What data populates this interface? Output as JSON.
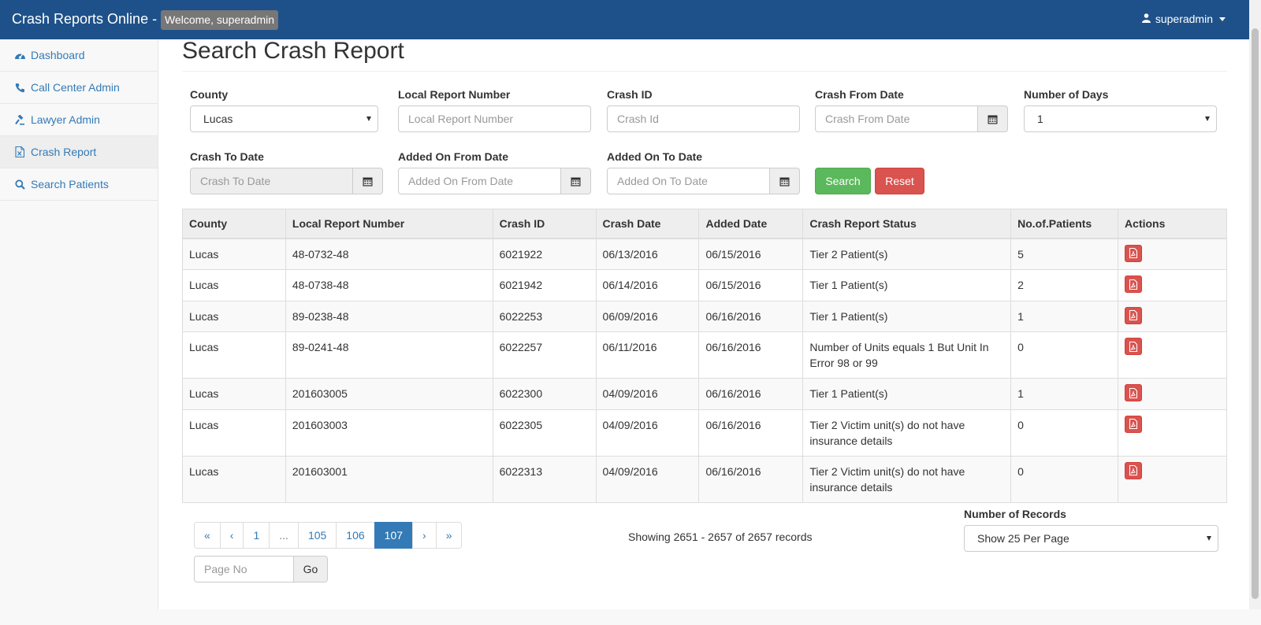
{
  "navbar": {
    "brand": "Crash Reports Online -",
    "welcome": "Welcome, superadmin",
    "user": "superadmin"
  },
  "sidebar": {
    "items": [
      {
        "label": "Dashboard",
        "icon": "dashboard-icon"
      },
      {
        "label": "Call Center Admin",
        "icon": "phone-icon"
      },
      {
        "label": "Lawyer Admin",
        "icon": "gavel-icon"
      },
      {
        "label": "Crash Report",
        "icon": "file-excel-icon"
      },
      {
        "label": "Search Patients",
        "icon": "search-icon"
      }
    ]
  },
  "page": {
    "title": "Search Crash Report"
  },
  "filters": {
    "county_label": "County",
    "county_value": "Lucas",
    "local_report_label": "Local Report Number",
    "local_report_placeholder": "Local Report Number",
    "crash_id_label": "Crash ID",
    "crash_id_placeholder": "Crash Id",
    "crash_from_label": "Crash From Date",
    "crash_from_placeholder": "Crash From Date",
    "num_days_label": "Number of Days",
    "num_days_value": "1",
    "crash_to_label": "Crash To Date",
    "crash_to_placeholder": "Crash To Date",
    "added_from_label": "Added On From Date",
    "added_from_placeholder": "Added On From Date",
    "added_to_label": "Added On To Date",
    "added_to_placeholder": "Added On To Date",
    "search_label": "Search",
    "reset_label": "Reset"
  },
  "table": {
    "headers": [
      "County",
      "Local Report Number",
      "Crash ID",
      "Crash Date",
      "Added Date",
      "Crash Report Status",
      "No.of.Patients",
      "Actions"
    ],
    "rows": [
      {
        "county": "Lucas",
        "local": "48-0732-48",
        "crash_id": "6021922",
        "crash_date": "06/13/2016",
        "added": "06/15/2016",
        "status": "Tier 2 Patient(s)",
        "patients": "5"
      },
      {
        "county": "Lucas",
        "local": "48-0738-48",
        "crash_id": "6021942",
        "crash_date": "06/14/2016",
        "added": "06/15/2016",
        "status": "Tier 1 Patient(s)",
        "patients": "2"
      },
      {
        "county": "Lucas",
        "local": "89-0238-48",
        "crash_id": "6022253",
        "crash_date": "06/09/2016",
        "added": "06/16/2016",
        "status": "Tier 1 Patient(s)",
        "patients": "1"
      },
      {
        "county": "Lucas",
        "local": "89-0241-48",
        "crash_id": "6022257",
        "crash_date": "06/11/2016",
        "added": "06/16/2016",
        "status": "Number of Units equals 1 But Unit In Error 98 or 99",
        "patients": "0"
      },
      {
        "county": "Lucas",
        "local": "201603005",
        "crash_id": "6022300",
        "crash_date": "04/09/2016",
        "added": "06/16/2016",
        "status": "Tier 1 Patient(s)",
        "patients": "1"
      },
      {
        "county": "Lucas",
        "local": "201603003",
        "crash_id": "6022305",
        "crash_date": "04/09/2016",
        "added": "06/16/2016",
        "status": "Tier 2 Victim unit(s) do not have insurance details",
        "patients": "0"
      },
      {
        "county": "Lucas",
        "local": "201603001",
        "crash_id": "6022313",
        "crash_date": "04/09/2016",
        "added": "06/16/2016",
        "status": "Tier 2 Victim unit(s) do not have insurance details",
        "patients": "0"
      }
    ],
    "action_icon": "pdf-icon"
  },
  "pagination": {
    "items": [
      "«",
      "‹",
      "1",
      "...",
      "105",
      "106",
      "107",
      "›",
      "»"
    ],
    "active": "107",
    "showing": "Showing 2651 - 2657 of 2657 records",
    "page_no_placeholder": "Page No",
    "go_label": "Go",
    "records_label": "Number of Records",
    "records_value": "Show 25 Per Page"
  },
  "colors": {
    "navbar": "#1e5189",
    "link": "#337ab7",
    "success": "#5cb85c",
    "danger": "#d9534f"
  }
}
